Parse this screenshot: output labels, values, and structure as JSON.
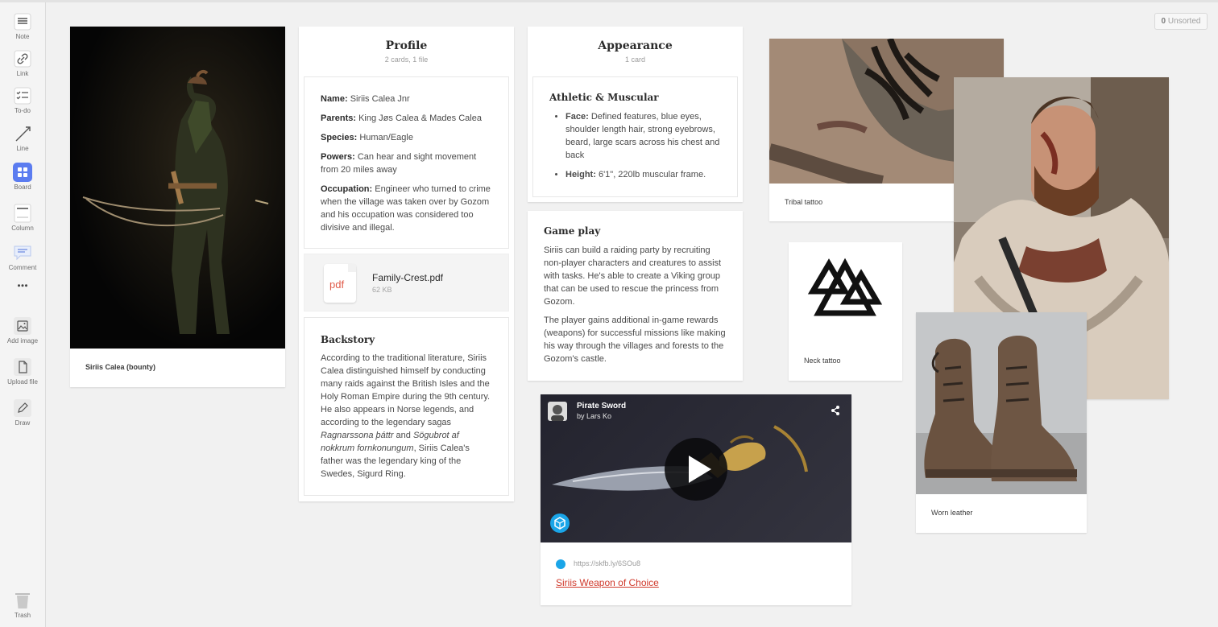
{
  "sidebar": {
    "tools": [
      {
        "label": "Note",
        "icon": "note-icon"
      },
      {
        "label": "Link",
        "icon": "link-icon"
      },
      {
        "label": "To-do",
        "icon": "todo-icon"
      },
      {
        "label": "Line",
        "icon": "line-icon"
      },
      {
        "label": "Board",
        "icon": "board-icon"
      },
      {
        "label": "Column",
        "icon": "column-icon"
      },
      {
        "label": "Comment",
        "icon": "comment-icon"
      },
      {
        "label": "Add image",
        "icon": "image-icon"
      },
      {
        "label": "Upload file",
        "icon": "file-icon"
      },
      {
        "label": "Draw",
        "icon": "pencil-icon"
      },
      {
        "label": "Trash",
        "icon": "trash-icon"
      }
    ],
    "accent": "#5b7cf0"
  },
  "unsorted": {
    "count": "0",
    "label": "Unsorted"
  },
  "hero": {
    "caption": "Siriis Calea (bounty)"
  },
  "profile": {
    "title": "Profile",
    "subtitle": "2 cards, 1 file",
    "fields": [
      {
        "key": "Name:",
        "value": "Siriis Calea Jnr"
      },
      {
        "key": "Parents:",
        "value": "King Jøs Calea & Mades Calea"
      },
      {
        "key": "Species:",
        "value": "Human/Eagle"
      },
      {
        "key": "Powers:",
        "value": "Can hear and sight movement from 20 miles away"
      },
      {
        "key": "Occupation:",
        "value": "Engineer who turned to crime when the village was taken over by Gozom and his occupation was considered too divisive and illegal."
      }
    ],
    "file": {
      "badge": "pdf",
      "name": "Family-Crest.pdf",
      "size": "62 KB"
    },
    "backstory": {
      "title": "Backstory",
      "text_a": "According to the traditional literature, Siriis Calea distinguished himself by conducting many raids against the British Isles and the Holy Roman Empire during the 9th century. He also appears in Norse legends, and according to the legendary sagas ",
      "italic_a": "Ragnarssona þáttr",
      "text_b": " and ",
      "italic_b": "Sögubrot af nokkrum fornkonungum",
      "text_c": ", Siriis Calea's father was the legendary king of the Swedes, Sigurd Ring."
    }
  },
  "appearance": {
    "title": "Appearance",
    "subtitle": "1 card",
    "section_title": "Athletic & Muscular",
    "bullets": [
      {
        "key": "Face:",
        "value": "Defined features, blue eyes, shoulder length hair, strong eyebrows, beard, large scars across his chest and back"
      },
      {
        "key": "Height:",
        "value": "6'1\", 220lb muscular frame."
      }
    ]
  },
  "gameplay": {
    "title": "Game play",
    "para1": "Siriis can build a raiding party by recruiting non-player characters and creatures to assist with tasks. He's able to create a Viking group that can be used to rescue the princess from Gozom.",
    "para2": "The player gains additional in-game rewards (weapons) for successful missions like making his way through the villages and forests to the Gozom's castle."
  },
  "video": {
    "title": "Pirate Sword",
    "author": "by Lars Ko",
    "url": "https://skfb.ly/6SOu8",
    "link_text": "Siriis Weapon of Choice"
  },
  "images": {
    "tribal": "Tribal tattoo",
    "neck": "Neck tattoo",
    "leather": "Worn leather"
  }
}
